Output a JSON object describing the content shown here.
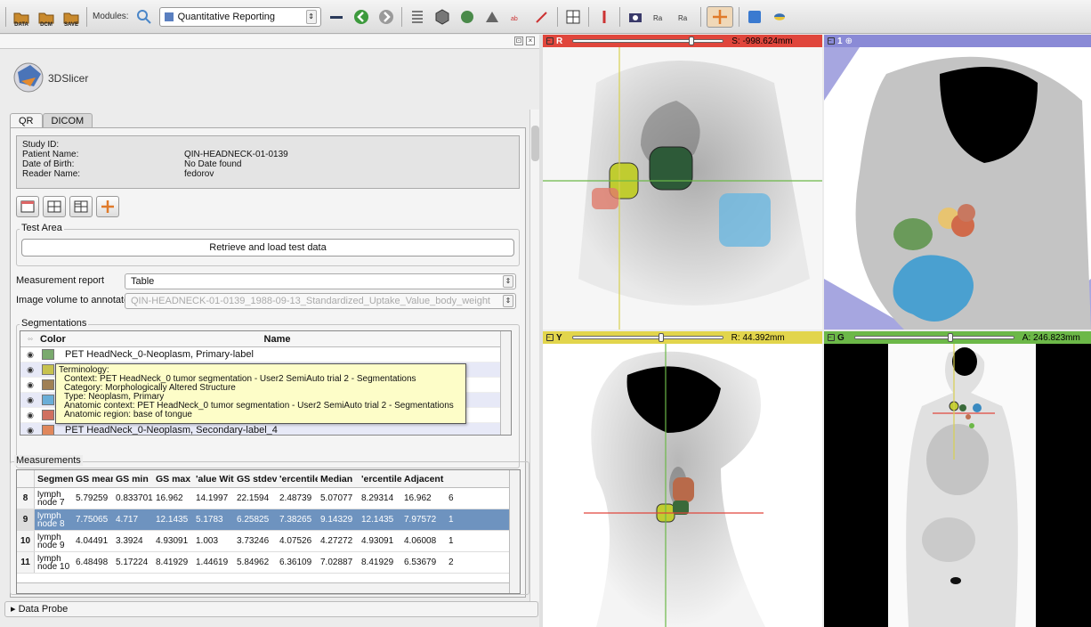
{
  "toolbar": {
    "data_label": "DATA",
    "dcm_label": "DCM",
    "save_label": "SAVE",
    "modules_label": "Modules:",
    "module_selected": "Quantitative Reporting"
  },
  "logo": {
    "text": "3DSlicer"
  },
  "tabs": [
    {
      "label": "QR"
    },
    {
      "label": "DICOM"
    }
  ],
  "study_info": {
    "study_id_label": "Study ID:",
    "study_id_value": "",
    "patient_name_label": "Patient Name:",
    "patient_name_value": "QIN-HEADNECK-01-0139",
    "dob_label": "Date of Birth:",
    "dob_value": "No Date found",
    "reader_label": "Reader Name:",
    "reader_value": "fedorov"
  },
  "test_area": {
    "title": "Test Area",
    "button": "Retrieve and load test data"
  },
  "form": {
    "report_label": "Measurement report",
    "report_value": "Table",
    "volume_label": "Image volume to annotate",
    "volume_value": "QIN-HEADNECK-01-0139_1988-09-13_Standardized_Uptake_Value_body_weight"
  },
  "segmentations": {
    "title": "Segmentations",
    "col_color": "Color",
    "col_name": "Name",
    "rows": [
      {
        "name": "PET HeadNeck_0-Neoplasm, Primary-label",
        "color": "#7aaa6e"
      },
      {
        "name": "",
        "color": "#c7c24f"
      },
      {
        "name": "",
        "color": "#a08055"
      },
      {
        "name": "",
        "color": "#6aaed8"
      },
      {
        "name": "",
        "color": "#d07060"
      },
      {
        "name": "PET HeadNeck_0-Neoplasm, Secondary-label_4",
        "color": "#e0875c"
      }
    ]
  },
  "tooltip": {
    "line1": "Terminology:",
    "line2": "Context: PET HeadNeck_0 tumor segmentation - User2 SemiAuto trial 2 - Segmentations",
    "line3": "Category: Morphologically Altered Structure",
    "line4": "Type: Neoplasm, Primary",
    "line5": "Anatomic context: PET HeadNeck_0 tumor segmentation - User2 SemiAuto trial 2 - Segmentations",
    "line6": "Anatomic region: base of tongue"
  },
  "measurements": {
    "title": "Measurements",
    "headers": [
      "Segment",
      "GS mean",
      "GS min",
      "GS max",
      "'alue With",
      "GS stdev",
      "'ercentile",
      "Median",
      "'ercentile",
      "Adjacent",
      ""
    ],
    "rows": [
      {
        "idx": "8",
        "cells": [
          "lymph node 7",
          "5.79259",
          "0.833701",
          "16.962",
          "14.1997",
          "22.1594",
          "2.48739",
          "5.07077",
          "8.29314",
          "16.962",
          "6"
        ]
      },
      {
        "idx": "9",
        "cells": [
          "lymph node 8",
          "7.75065",
          "4.717",
          "12.1435",
          "5.1783",
          "6.25825",
          "7.38265",
          "9.14329",
          "12.1435",
          "7.97572",
          "1"
        ]
      },
      {
        "idx": "10",
        "cells": [
          "lymph node 9",
          "4.04491",
          "3.3924",
          "4.93091",
          "1.003",
          "3.73246",
          "4.07526",
          "4.27272",
          "4.93091",
          "4.06008",
          "1"
        ]
      },
      {
        "idx": "11",
        "cells": [
          "lymph node 10",
          "6.48498",
          "5.17224",
          "8.41929",
          "1.44619",
          "5.84962",
          "6.36109",
          "7.02887",
          "8.41929",
          "6.53679",
          "2"
        ]
      }
    ]
  },
  "data_probe": {
    "label": "Data Probe"
  },
  "views": {
    "red": {
      "name": "R",
      "value": "S: -998.624mm",
      "color": "#e0463c"
    },
    "threed": {
      "name": "1",
      "color": "#8a8ad6"
    },
    "yellow": {
      "name": "Y",
      "value": "R: 44.392mm",
      "color": "#e2d54c"
    },
    "green": {
      "name": "G",
      "value": "A: 246.823mm",
      "color": "#6cb848"
    }
  }
}
